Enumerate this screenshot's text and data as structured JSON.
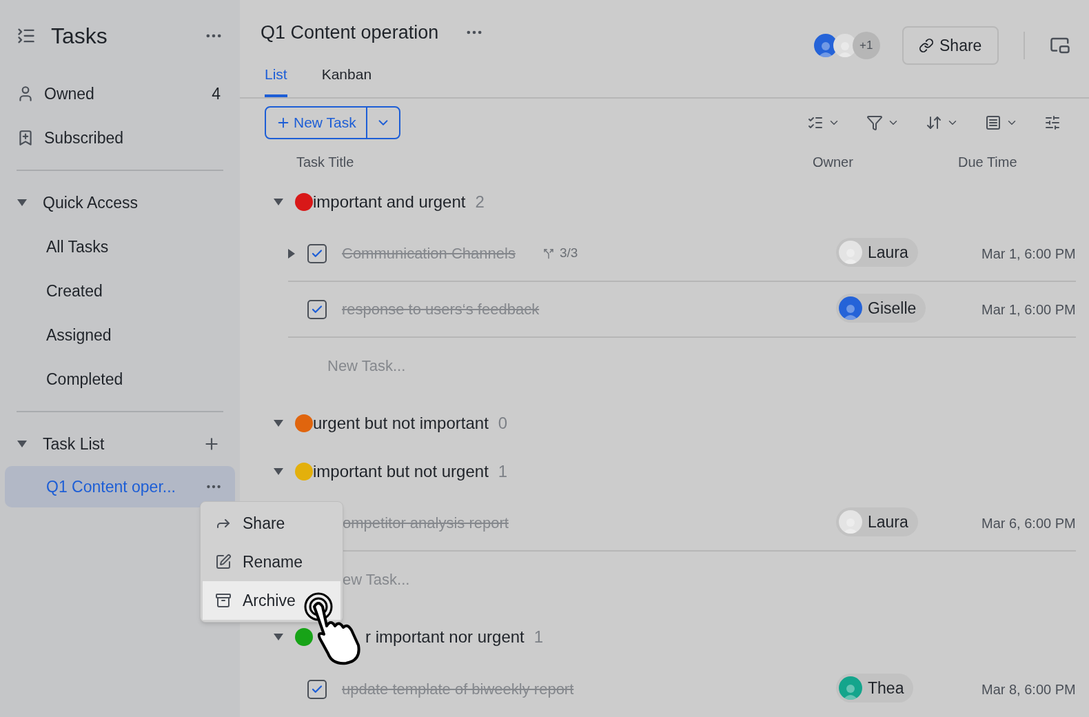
{
  "sidebar": {
    "title": "Tasks",
    "nav": [
      {
        "label": "Owned",
        "count": "4",
        "kind": "person"
      },
      {
        "label": "Subscribed",
        "kind": "bookmark"
      }
    ],
    "quick_access": {
      "label": "Quick Access",
      "items": [
        "All Tasks",
        "Created",
        "Assigned",
        "Completed"
      ]
    },
    "task_list": {
      "label": "Task List",
      "items": [
        {
          "label": "Q1 Content oper...",
          "selected": true
        }
      ]
    }
  },
  "context_menu": {
    "items": [
      {
        "label": "Share",
        "kind": "share",
        "highlighted": false
      },
      {
        "label": "Rename",
        "kind": "rename",
        "highlighted": false
      },
      {
        "label": "Archive",
        "kind": "archive",
        "highlighted": true
      }
    ]
  },
  "header": {
    "title": "Q1 Content operation",
    "extra_members": "+1",
    "share_button": "Share"
  },
  "tabs": [
    {
      "label": "List",
      "selected": true
    },
    {
      "label": "Kanban",
      "selected": false
    }
  ],
  "new_task_button": "New Task",
  "table": {
    "columns": [
      "Task Title",
      "Owner",
      "Due Time"
    ],
    "groups": [
      {
        "name": "important and urgent",
        "count": "2",
        "color": "#d81818",
        "tasks": [
          {
            "title": "Communication Channels",
            "completed": true,
            "expandable": true,
            "subtasks": "3/3",
            "owner": {
              "name": "Laura",
              "color": "#e4e4e4"
            },
            "due": "Mar 1, 6:00 PM"
          },
          {
            "title": "response to users‘s feedback",
            "completed": true,
            "expandable": false,
            "owner": {
              "name": "Giselle",
              "color": "#2563d8"
            },
            "due": "Mar 1, 6:00 PM"
          }
        ],
        "new_task": {
          "label": "New Task..."
        }
      },
      {
        "name": "urgent but not important",
        "count": "0",
        "color": "#e0650e"
      },
      {
        "name": "important but not urgent",
        "count": "1",
        "color": "#e3b00c",
        "tasks": [
          {
            "title": "ompetitor analysis report",
            "completed": true,
            "covered": true,
            "owner": {
              "name": "Laura",
              "color": "#e4e4e4"
            },
            "due": "Mar 6, 6:00 PM"
          }
        ],
        "new_task": {
          "label": "ew Task...",
          "covered": true
        }
      },
      {
        "name": "r important nor urgent",
        "count": "1",
        "color": "#17a317",
        "covered": true,
        "tasks": [
          {
            "title": "update template of biweekly report",
            "completed": true,
            "expandable": false,
            "owner": {
              "name": "Thea",
              "color": "#14a58c"
            },
            "due": "Mar 8, 6:00 PM"
          }
        ]
      }
    ]
  }
}
